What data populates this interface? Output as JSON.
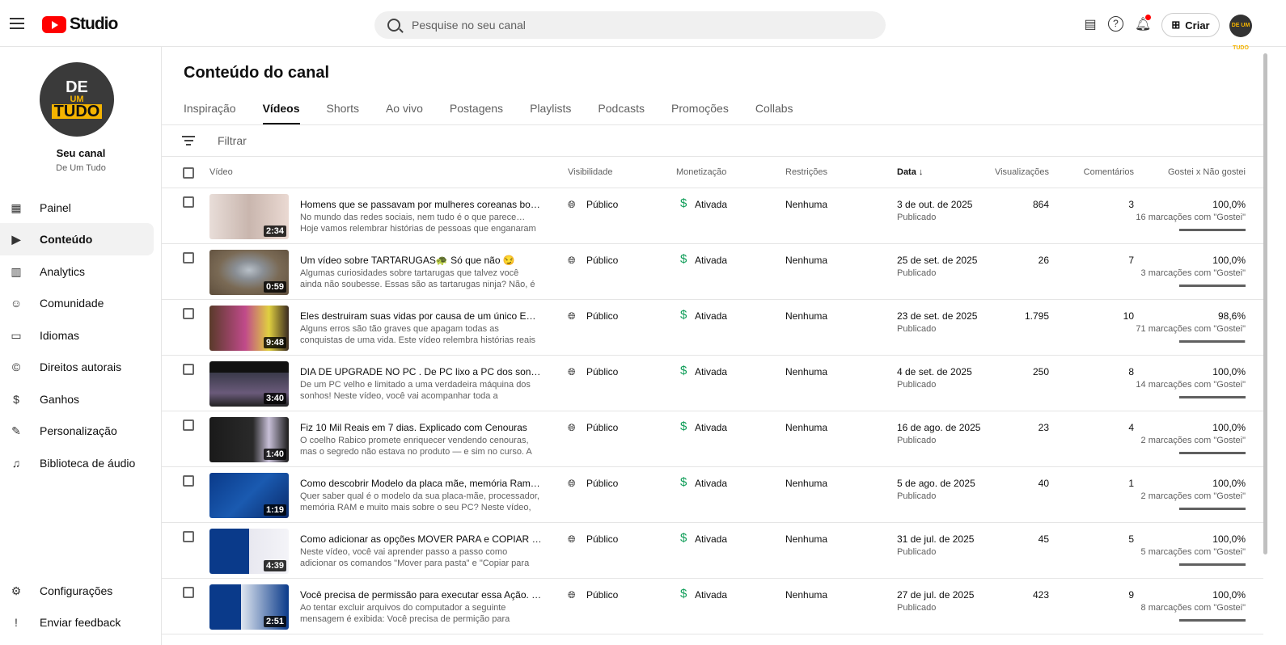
{
  "header": {
    "logo": "Studio",
    "search_placeholder": "Pesquise no seu canal",
    "create": "Criar",
    "avatar_text": "DE UM TUDO"
  },
  "sidebar": {
    "avatar": {
      "l1": "DE",
      "l2": "UM",
      "l3": "TUDO"
    },
    "channel_label": "Seu canal",
    "channel_name": "De Um Tudo",
    "items": [
      {
        "label": "Painel",
        "icon": "▦"
      },
      {
        "label": "Conteúdo",
        "icon": "▶"
      },
      {
        "label": "Analytics",
        "icon": "▥"
      },
      {
        "label": "Comunidade",
        "icon": "☺"
      },
      {
        "label": "Idiomas",
        "icon": "▭"
      },
      {
        "label": "Direitos autorais",
        "icon": "©"
      },
      {
        "label": "Ganhos",
        "icon": "$"
      },
      {
        "label": "Personalização",
        "icon": "✎"
      },
      {
        "label": "Biblioteca de áudio",
        "icon": "♫"
      }
    ],
    "bottom": [
      {
        "label": "Configurações",
        "icon": "⚙"
      },
      {
        "label": "Enviar feedback",
        "icon": "!"
      }
    ]
  },
  "main": {
    "title": "Conteúdo do canal",
    "tabs": [
      "Inspiração",
      "Vídeos",
      "Shorts",
      "Ao vivo",
      "Postagens",
      "Playlists",
      "Podcasts",
      "Promoções",
      "Collabs"
    ],
    "filter": "Filtrar",
    "columns": {
      "video": "Vídeo",
      "visibility": "Visibilidade",
      "monetization": "Monetização",
      "restrictions": "Restrições",
      "date": "Data ↓",
      "views": "Visualizações",
      "comments": "Comentários",
      "likes": "Gostei x Não gostei"
    }
  },
  "colors": {
    "accent": "#ff0000",
    "money": "#0f9d58"
  },
  "videos": [
    {
      "title": "Homens que se passavam por mulheres coreanas bonitas pr...",
      "desc": "No mundo das redes sociais, nem tudo é o que parece… Hoje vamos relembrar histórias de pessoas que enganaram milhares...",
      "duration": "2:34",
      "visibility": "Público",
      "monetization": "Ativada",
      "restrictions": "Nenhuma",
      "date": "3 de out. de 2025",
      "status": "Publicado",
      "views": "864",
      "comments": "3",
      "likes_pct": "100,0%",
      "likes_count": "16 marcações com \"Gostei\"",
      "likes_ratio": 1.0,
      "thumb": "linear-gradient(90deg,#e8ddd8,#c9b6ae 50%,#ead9d2)"
    },
    {
      "title": "Um vídeo sobre TARTARUGAS🐢 Só que não 😏",
      "desc": "Algumas curiosidades sobre tartarugas que talvez você ainda não soubesse. Essas são as tartarugas ninja? Não, é apenas um...",
      "duration": "0:59",
      "visibility": "Público",
      "monetization": "Ativada",
      "restrictions": "Nenhuma",
      "date": "25 de set. de 2025",
      "status": "Publicado",
      "views": "26",
      "comments": "7",
      "likes_pct": "100,0%",
      "likes_count": "3 marcações com \"Gostei\"",
      "likes_ratio": 1.0,
      "thumb": "radial-gradient(ellipse at 50% 45%,#b8c0c8 0,#8a8f95 25%,#7a6a55 55%,#5e4e3c)"
    },
    {
      "title": "Eles destruiram suas vidas por causa de um único ERRO",
      "desc": "Alguns erros são tão graves que apagam todas as conquistas de uma vida. Este vídeo relembra histórias reais de pessoas que...",
      "duration": "9:48",
      "visibility": "Público",
      "monetization": "Ativada",
      "restrictions": "Nenhuma",
      "date": "23 de set. de 2025",
      "status": "Publicado",
      "views": "1.795",
      "comments": "10",
      "likes_pct": "98,6%",
      "likes_count": "71 marcações com \"Gostei\"",
      "likes_ratio": 0.986,
      "thumb": "linear-gradient(90deg,#5a3a2a,#c04a8a 45%,#e0d040 75%,#3a2a20)"
    },
    {
      "title": "DIA DE UPGRADE NO PC . De PC lixo a PC dos sonhos. Se eu ...",
      "desc": "De um PC velho e limitado a uma verdadeira máquina dos sonhos! Neste vídeo, você vai acompanhar toda a transformação do meu...",
      "duration": "3:40",
      "visibility": "Público",
      "monetization": "Ativada",
      "restrictions": "Nenhuma",
      "date": "4 de set. de 2025",
      "status": "Publicado",
      "views": "250",
      "comments": "8",
      "likes_pct": "100,0%",
      "likes_count": "14 marcações com \"Gostei\"",
      "likes_ratio": 1.0,
      "thumb": "linear-gradient(180deg,#111 0,#111 25%,#3a3a4a 25%,#6a5a7a 70%,#222)"
    },
    {
      "title": "Fiz 10 Mil Reais em 7 dias. Explicado com Cenouras",
      "desc": "O coelho Rabico promete enriquecer vendendo cenouras, mas o segredo não estava no produto — e sim no curso. A história revel...",
      "duration": "1:40",
      "visibility": "Público",
      "monetization": "Ativada",
      "restrictions": "Nenhuma",
      "date": "16 de ago. de 2025",
      "status": "Publicado",
      "views": "23",
      "comments": "4",
      "likes_pct": "100,0%",
      "likes_count": "2 marcações com \"Gostei\"",
      "likes_ratio": 1.0,
      "thumb": "linear-gradient(90deg,#1a1a1a,#2a2a2a 55%,#c8c0d8 75%,#1a1a1a)"
    },
    {
      "title": "Como descobrir Modelo da placa mãe, memória Ram, proces...",
      "desc": "Quer saber qual é o modelo da sua placa-mãe, processador, memória RAM e muito mais sobre o seu PC? Neste vídeo, eu te...",
      "duration": "1:19",
      "visibility": "Público",
      "monetization": "Ativada",
      "restrictions": "Nenhuma",
      "date": "5 de ago. de 2025",
      "status": "Publicado",
      "views": "40",
      "comments": "1",
      "likes_pct": "100,0%",
      "likes_count": "2 marcações com \"Gostei\"",
      "likes_ratio": 1.0,
      "thumb": "linear-gradient(135deg,#0a3a8a,#1a5ab0 50%,#0a2a6a)"
    },
    {
      "title": "Como adicionar as opções MOVER PARA e COPIAR PARA no ...",
      "desc": "Neste vídeo, você vai aprender passo a passo como adicionar os comandos \"Mover para pasta\" e \"Copiar para pasta\" no menu de...",
      "duration": "4:39",
      "visibility": "Público",
      "monetization": "Ativada",
      "restrictions": "Nenhuma",
      "date": "31 de jul. de 2025",
      "status": "Publicado",
      "views": "45",
      "comments": "5",
      "likes_pct": "100,0%",
      "likes_count": "5 marcações com \"Gostei\"",
      "likes_ratio": 1.0,
      "thumb": "linear-gradient(90deg,#0a3a8a 0,#0a3a8a 50%,#e8e8f0 50%,#f4f4f8)"
    },
    {
      "title": "Você precisa de permissão para executar essa Ação. Resolvi...",
      "desc": "Ao tentar excluir arquivos do computador a seguinte mensagem é exibida: Você precisa de permição para executar essa Ação. ou...",
      "duration": "2:51",
      "visibility": "Público",
      "monetization": "Ativada",
      "restrictions": "Nenhuma",
      "date": "27 de jul. de 2025",
      "status": "Publicado",
      "views": "423",
      "comments": "9",
      "likes_pct": "100,0%",
      "likes_count": "8 marcações com \"Gostei\"",
      "likes_ratio": 1.0,
      "thumb": "linear-gradient(90deg,#0a3a8a 0,#0a3a8a 40%,#dfe6f0 40%,#0a3a8a 100%)"
    }
  ]
}
